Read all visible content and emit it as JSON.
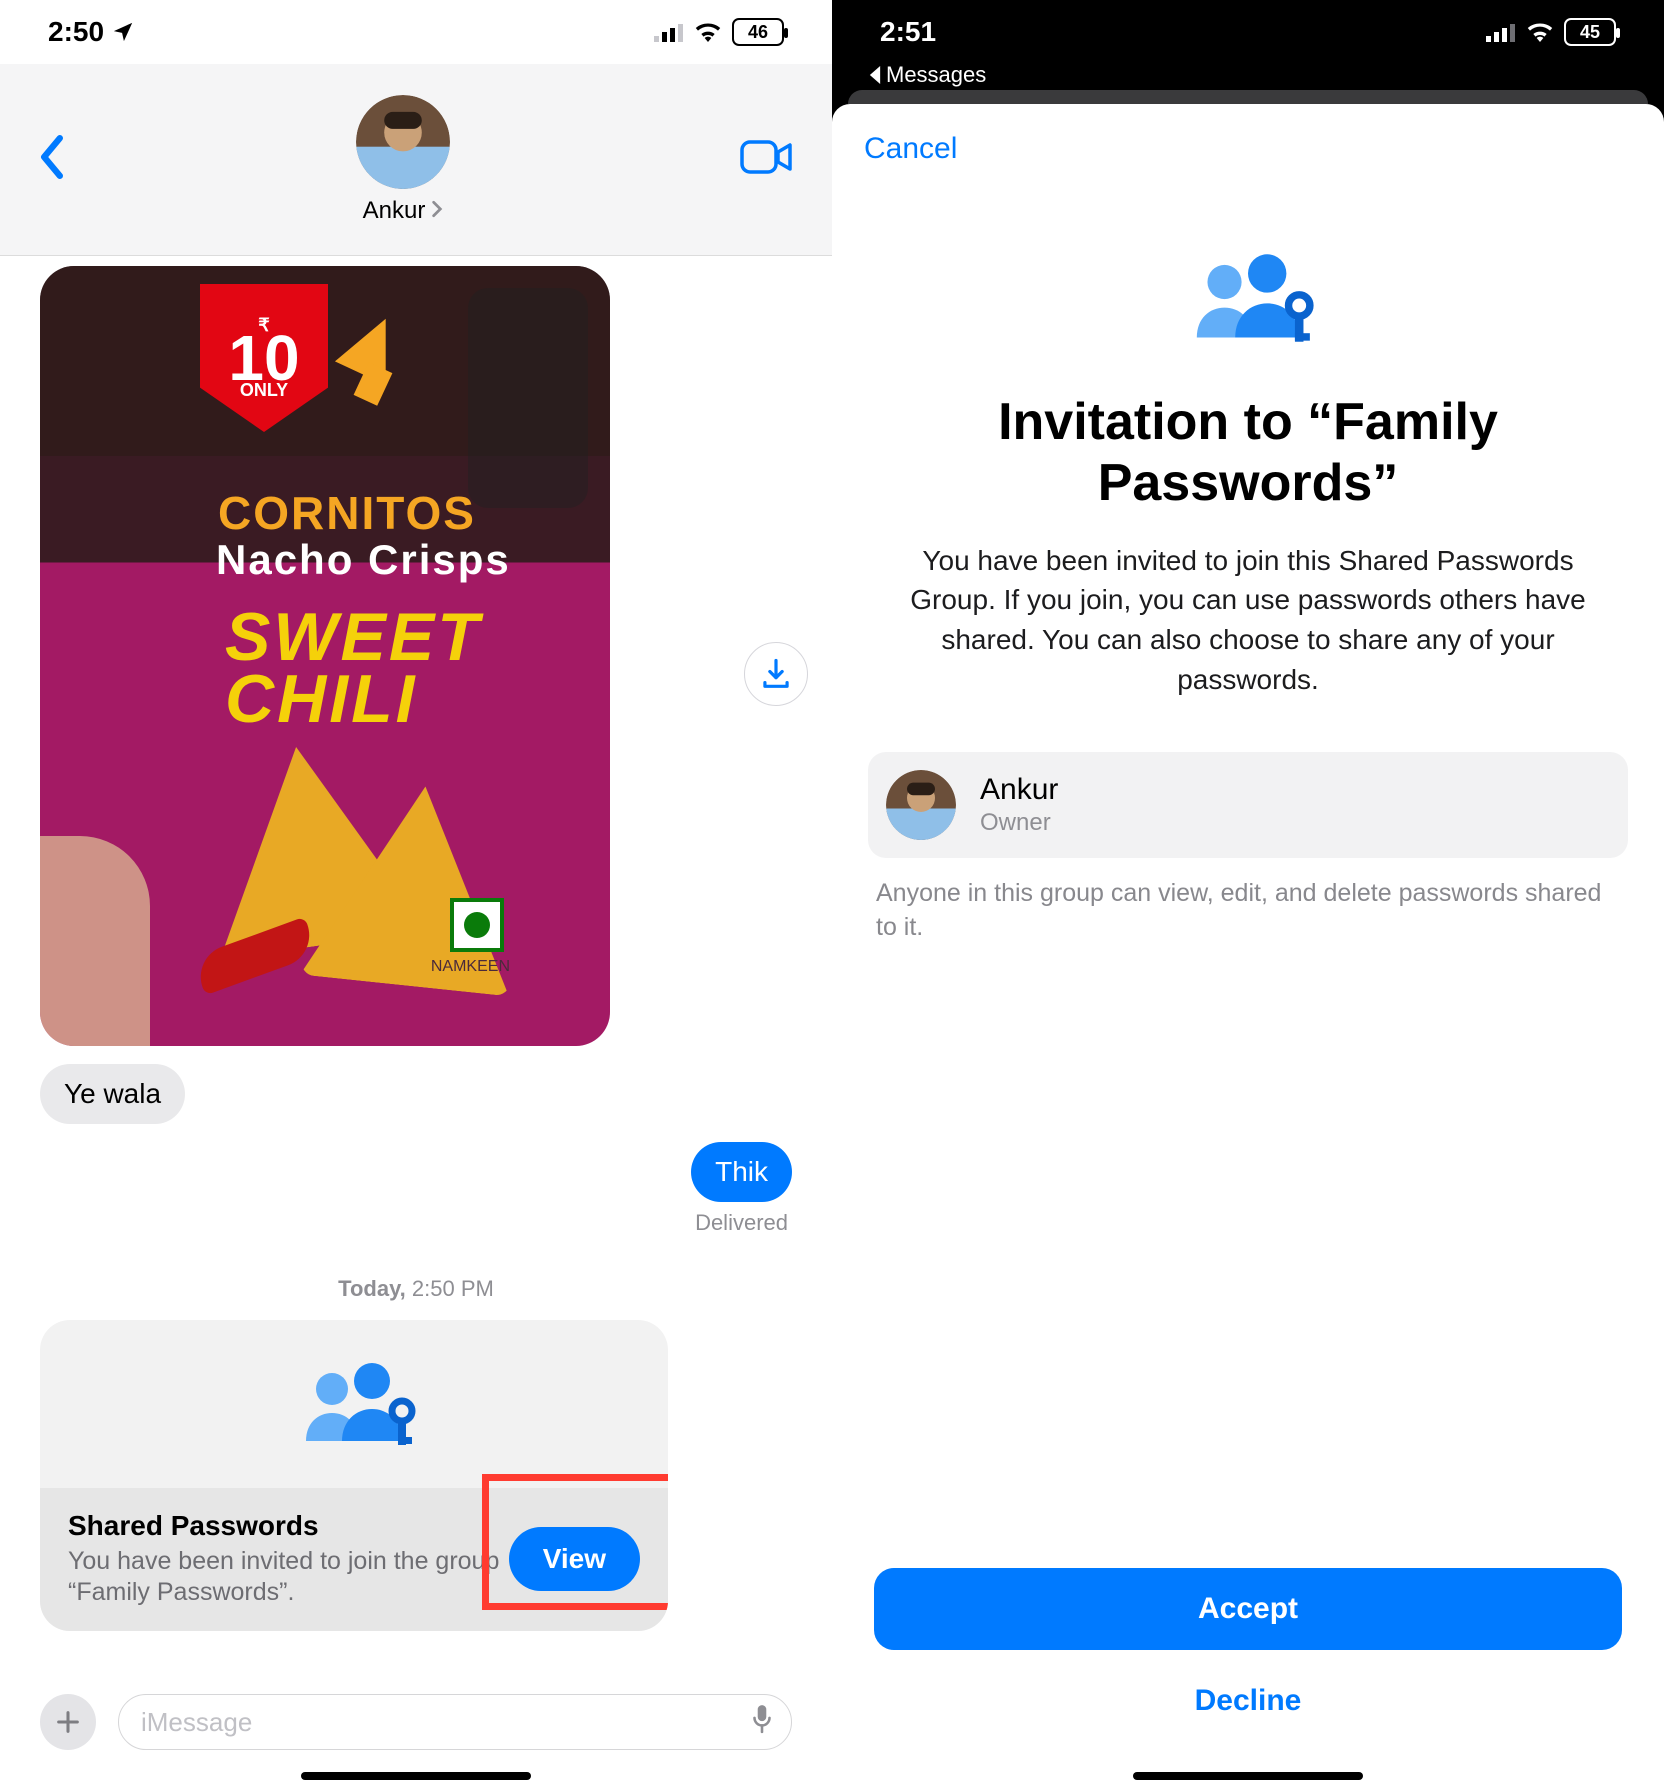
{
  "left": {
    "status": {
      "time": "2:50",
      "battery": "46"
    },
    "header": {
      "contact_name": "Ankur"
    },
    "photo": {
      "price_prefix": "₹",
      "price_value": "10",
      "price_only": "ONLY",
      "brand": "CORNITOS",
      "product": "Nacho Crisps",
      "flavor_line1": "SWEET",
      "flavor_line2": "CHILI",
      "namkeen": "NAMKEEN"
    },
    "messages": {
      "incoming_text": "Ye wala",
      "outgoing_text": "Thik",
      "delivered": "Delivered",
      "timestamp_day": "Today,",
      "timestamp_time": " 2:50 PM"
    },
    "invite_card": {
      "title": "Shared Passwords",
      "desc": "You have been invited to join the group “Family Passwords”.",
      "view": "View"
    },
    "compose": {
      "placeholder": "iMessage"
    }
  },
  "right": {
    "status": {
      "time": "2:51",
      "battery": "45",
      "back_app": "Messages"
    },
    "sheet": {
      "cancel": "Cancel",
      "title": "Invitation to “Family Passwords”",
      "desc": "You have been invited to join this Shared Passwords Group. If you join, you can use passwords others have shared. You can also choose to share any of your passwords.",
      "owner_name": "Ankur",
      "owner_role": "Owner",
      "owner_note": "Anyone in this group can view, edit, and delete passwords shared to it.",
      "accept": "Accept",
      "decline": "Decline"
    }
  }
}
